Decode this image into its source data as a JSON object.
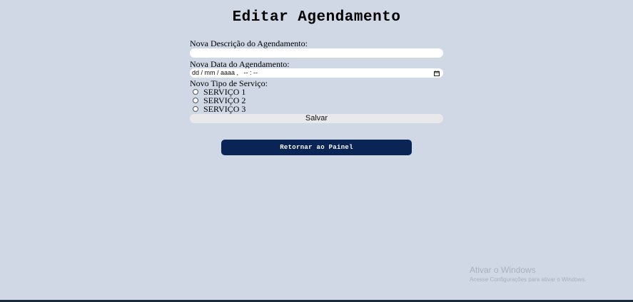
{
  "page": {
    "title": "Editar Agendamento"
  },
  "form": {
    "description_label": "Nova Descrição do Agendamento:",
    "description_value": "",
    "date_label": "Nova Data do Agendamento:",
    "date_placeholder": "dd / mm / aaaa ,   -- : --",
    "date_icon": "calendar-icon",
    "service_label": "Novo Tipo de Serviço:",
    "service_options": [
      {
        "label": "SERVIÇO 1",
        "selected": false
      },
      {
        "label": "SERVIÇO 2",
        "selected": false
      },
      {
        "label": "SERVIÇO 3",
        "selected": false
      }
    ],
    "save_label": "Salvar"
  },
  "actions": {
    "return_label": "Retornar ao Painel"
  },
  "watermark": {
    "title": "Ativar o Windows",
    "subtitle": "Acesse Configurações para ativar o Windows."
  },
  "colors": {
    "background": "#d0d7e5",
    "primary_button": "#0a2456",
    "save_button": "#e9e9ec"
  }
}
